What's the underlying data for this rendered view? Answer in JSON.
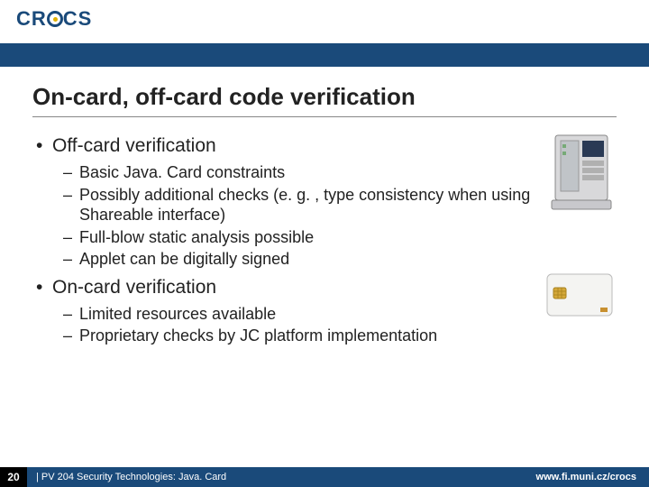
{
  "logo_text": "CR   CS",
  "title": "On-card, off-card code verification",
  "section1": {
    "heading": "Off-card verification",
    "items": [
      "Basic Java. Card constraints",
      "Possibly additional checks (e. g. , type consistency when using Shareable interface)",
      "Full-blow static analysis possible",
      "Applet can be digitally signed"
    ]
  },
  "section2": {
    "heading": "On-card verification",
    "items": [
      "Limited resources available",
      "Proprietary checks by JC platform implementation"
    ]
  },
  "footer": {
    "page": "20",
    "course": "| PV 204 Security Technologies: Java. Card",
    "url": "www.fi.muni.cz/crocs"
  },
  "icons": {
    "server": "server-computer-icon",
    "smartcard": "smartcard-icon"
  }
}
